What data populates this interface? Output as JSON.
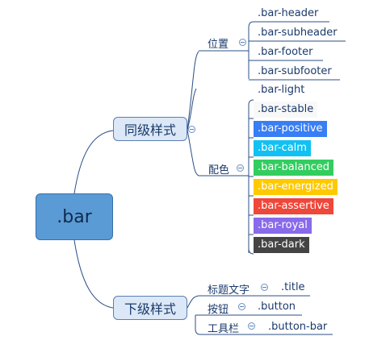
{
  "root": {
    "label": ".bar"
  },
  "branches": [
    {
      "label": "同级样式",
      "groups": [
        {
          "label": "位置",
          "items": [
            {
              "label": ".bar-header"
            },
            {
              "label": ".bar-subheader"
            },
            {
              "label": ".bar-footer"
            },
            {
              "label": ".bar-subfooter"
            }
          ]
        },
        {
          "label": "配色",
          "items": [
            {
              "label": ".bar-light",
              "bg": "#ffffff",
              "fg": "#1a3a6b"
            },
            {
              "label": ".bar-stable",
              "bg": "#f8f8f8",
              "fg": "#1a3a6b"
            },
            {
              "label": ".bar-positive",
              "bg": "#387ef5",
              "fg": "#ffffff"
            },
            {
              "label": ".bar-calm",
              "bg": "#11c1f3",
              "fg": "#ffffff"
            },
            {
              "label": ".bar-balanced",
              "bg": "#33cd5f",
              "fg": "#ffffff"
            },
            {
              "label": ".bar-energized",
              "bg": "#ffc900",
              "fg": "#ffffff"
            },
            {
              "label": ".bar-assertive",
              "bg": "#ef473a",
              "fg": "#ffffff"
            },
            {
              "label": ".bar-royal",
              "bg": "#886aea",
              "fg": "#ffffff"
            },
            {
              "label": ".bar-dark",
              "bg": "#444444",
              "fg": "#ffffff"
            }
          ]
        }
      ]
    },
    {
      "label": "下级样式",
      "groups": [
        {
          "label": "标题文字",
          "items": [
            {
              "label": ".title"
            }
          ]
        },
        {
          "label": "按钮",
          "items": [
            {
              "label": ".button"
            }
          ]
        },
        {
          "label": "工具栏",
          "items": [
            {
              "label": ".button-bar"
            }
          ]
        }
      ]
    }
  ],
  "colors": {
    "line": "#2b4f86",
    "toggle": "#6a8fc4"
  }
}
